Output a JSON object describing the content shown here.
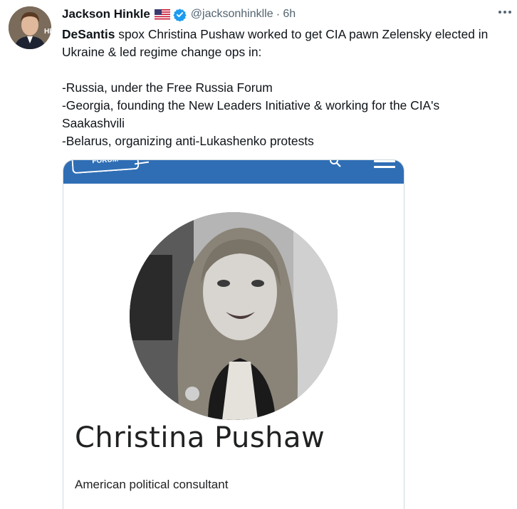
{
  "tweet": {
    "author_name": "Jackson Hinkle",
    "handle": "@jacksonhinklle",
    "separator": "·",
    "time": "6h",
    "more_icon": "more-horizontal-icon",
    "mention": "DeSantis",
    "lines": [
      " spox Christina Pushaw worked to get CIA pawn Zelensky elected in Ukraine & led regime change ops in:",
      "",
      "-Russia, under the Free Russia Forum",
      "-Georgia, founding the New Leaders Initiative & working for the CIA's Saakashvili",
      "-Belarus, organizing anti-Lukashenko protests"
    ]
  },
  "media": {
    "logo_text": "FORUM",
    "person_name": "Christina Pushaw",
    "person_description": "American political consultant"
  },
  "colors": {
    "verified_blue": "#1d9bf0",
    "media_bar": "#2f6eb5",
    "secondary_text": "#536471"
  }
}
